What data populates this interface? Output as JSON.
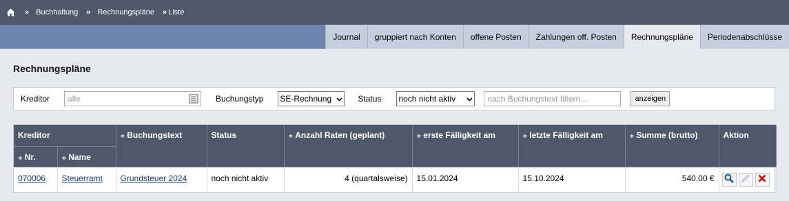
{
  "breadcrumb": {
    "home_icon": "home-icon",
    "sep": "»",
    "items": [
      "Buchhaltung",
      "Rechnungspläne",
      "Liste"
    ]
  },
  "tabs": [
    {
      "label": "Journal",
      "active": false
    },
    {
      "label": "gruppiert nach Konten",
      "active": false
    },
    {
      "label": "offene Posten",
      "active": false
    },
    {
      "label": "Zahlungen off. Posten",
      "active": false
    },
    {
      "label": "Rechnungspläne",
      "active": true
    },
    {
      "label": "Periodenabschlüsse",
      "active": false
    }
  ],
  "page_title": "Rechnungspläne",
  "filter": {
    "kreditor_label": "Kreditor",
    "kreditor_placeholder": "alle",
    "buchungstyp_label": "Buchungstyp",
    "buchungstyp_value": "SE-Rechnung",
    "status_label": "Status",
    "status_value": "noch nicht aktiv",
    "search_placeholder": "nach Buchungstext filtern...",
    "submit_label": "anzeigen"
  },
  "table": {
    "group_kreditor": "Kreditor",
    "sort_arrow": "≑",
    "headers": {
      "nr": "Nr.",
      "name": "Name",
      "buchungstext": "Buchungstext",
      "status": "Status",
      "raten": "Anzahl Raten (geplant)",
      "erste": "erste Fälligkeit am",
      "letzte": "letzte Fälligkeit am",
      "summe": "Summe (brutto)",
      "aktion": "Aktion"
    },
    "rows": [
      {
        "nr": "070006",
        "name": "Steuerramt",
        "buchungstext": "Grundsteuer 2024",
        "status": "noch nicht aktiv",
        "raten": "4 (quartalsweise)",
        "erste": "15.01.2024",
        "letzte": "15.10.2024",
        "summe": "540,00 €"
      }
    ]
  },
  "colors": {
    "header_bg": "#4f586a",
    "tab_band": "#6e86ad",
    "link": "#1a3d7a",
    "delete_red": "#d40000"
  }
}
